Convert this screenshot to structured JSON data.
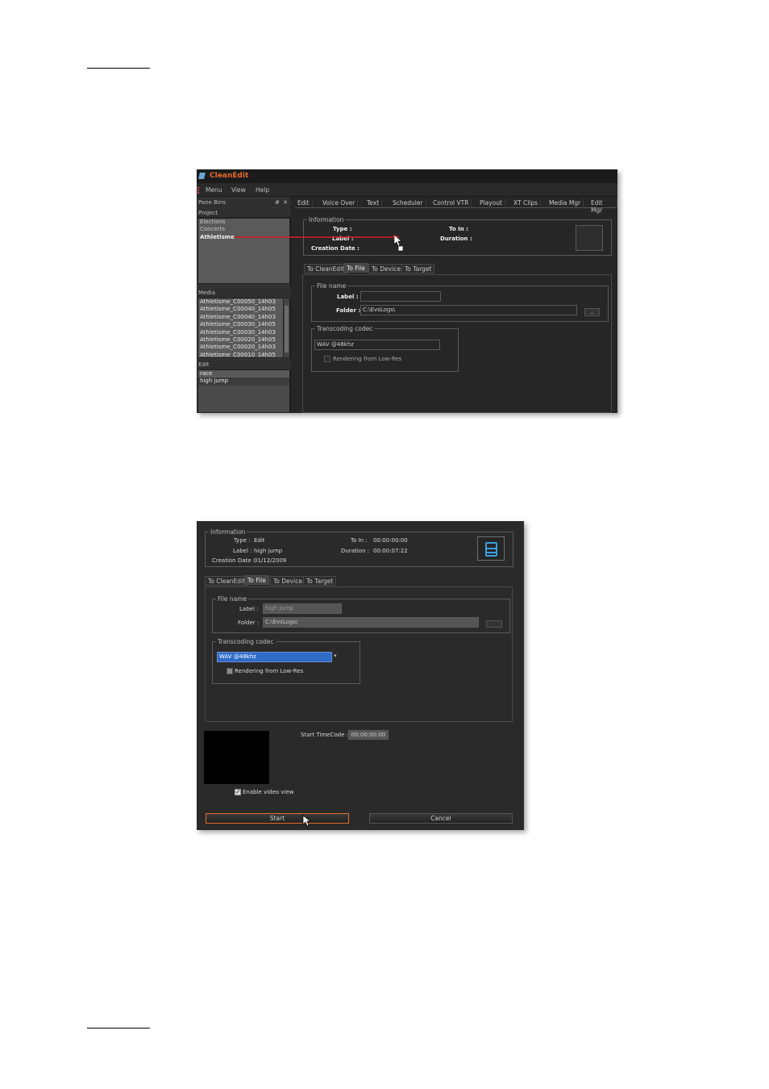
{
  "shot1": {
    "app_title": "CleanEdit",
    "menu": [
      "Menu",
      "View",
      "Help"
    ],
    "panes_title": "Pane Bins",
    "pane_controls": [
      "#",
      "✕"
    ],
    "project_header": "Project",
    "projects": [
      "Elections",
      "Concerts",
      "Athletisme"
    ],
    "media_header": "Media",
    "media_items": [
      "Athletisme_C00050_14h03",
      "Athletisme_C00040_14h05",
      "Athletisme_C00040_14h03",
      "Athletisme_C00030_14h05",
      "Athletisme_C00030_14h03",
      "Athletisme_C00020_14h05",
      "Athletisme_C00020_14h03",
      "Athletisme_C00010_14h05"
    ],
    "edit_header": "Edit",
    "edit_items": [
      "race",
      "high jump"
    ],
    "main_tabs": [
      "Edit",
      "Voice Over",
      "Text",
      "Scheduler",
      "Control VTR",
      "Playout",
      "XT Clips",
      "Media Mgr",
      "Edit Mgr"
    ],
    "information_title": "Information",
    "info_labels": {
      "type": "Type :",
      "label": "Label :",
      "creation_date": "Creation Date :",
      "to_in": "To In :",
      "duration": "Duration :"
    },
    "sub_tabs": [
      "To CleanEdit",
      "To File",
      "To Device",
      "To Target"
    ],
    "file_name_title": "File name",
    "label_caption": "Label :",
    "folder_caption": "Folder :",
    "folder_value": "C:\\EvsLogs\\",
    "browse_label": "...",
    "transcoding_title": "Transcoding codec",
    "codec_value": "WAV @48khz",
    "rendering_label": "Rendering from Low-Res"
  },
  "shot2": {
    "information_title": "Information",
    "info": {
      "type_label": "Type :",
      "type_value": "Edit",
      "label_label": "Label :",
      "label_value": "high jump",
      "creation_label": "Creation Date :",
      "creation_value": "01/12/2009",
      "to_in_label": "To In :",
      "to_in_value": "00:00:00:00",
      "duration_label": "Duration :",
      "duration_value": "00:00:07:22"
    },
    "sub_tabs": [
      "To CleanEdit",
      "To File",
      "To Device",
      "To Target"
    ],
    "file_name_title": "File name",
    "label_caption": "Label :",
    "label_value": "high jump",
    "folder_caption": "Folder :",
    "folder_value": "C:\\EvsLogs\\",
    "transcoding_title": "Transcoding codec",
    "codec_value": "WAV @48khz",
    "rendering_label": "Rendering from Low-Res",
    "start_timecode_label": "Start TimeCode :",
    "start_timecode_value": "00:00:00:00",
    "enable_video_label": "Enable video view",
    "start_button": "Start",
    "cancel_button": "Cancel"
  }
}
